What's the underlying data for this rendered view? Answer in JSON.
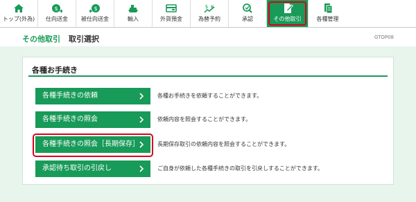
{
  "nav": {
    "items": [
      {
        "label": "トップ(外為)",
        "icon": "home-icon"
      },
      {
        "label": "仕向送金",
        "icon": "outward-remittance-icon"
      },
      {
        "label": "被仕向送金",
        "icon": "inward-remittance-icon"
      },
      {
        "label": "輸入",
        "icon": "import-ship-icon"
      },
      {
        "label": "外貨預金",
        "icon": "foreign-deposit-icon"
      },
      {
        "label": "為替予約",
        "icon": "fx-contract-icon"
      },
      {
        "label": "承認",
        "icon": "approval-icon"
      },
      {
        "label": "その他取引",
        "icon": "other-transactions-icon"
      },
      {
        "label": "各種管理",
        "icon": "management-icon"
      }
    ],
    "active_index": 7
  },
  "header": {
    "breadcrumb_section": "その他取引",
    "page_title": "取引選択",
    "screen_id": "GTOP08"
  },
  "panel": {
    "title": "各種お手続き",
    "rows": [
      {
        "button": "各種手続きの依頼",
        "description": "各種お手続きを依頼することができます。"
      },
      {
        "button": "各種手続きの照会",
        "description": "依頼内容を照会することができます。"
      },
      {
        "button": "各種手続きの照会［長期保存］",
        "description": "長期保存取引の依頼内容を照会することができます。"
      },
      {
        "button": "承認待ち取引の引戻し",
        "description": "ご自身が依頼した各種手続きの取引を引戻しすることができます。"
      }
    ]
  },
  "colors": {
    "accent_green": "#189a58",
    "highlight_red": "#d9001b",
    "background_tint": "#e8f5ec"
  }
}
